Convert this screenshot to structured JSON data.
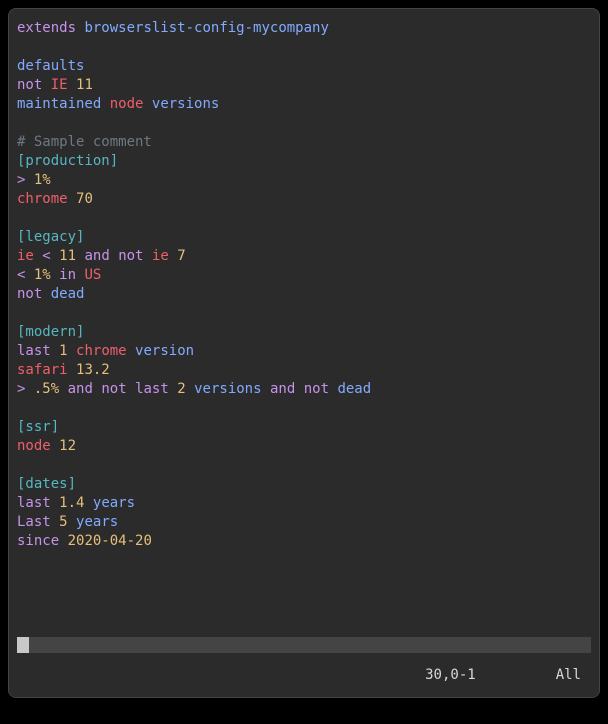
{
  "lines": [
    [
      [
        "keyword",
        "extends"
      ],
      [
        "plain",
        " "
      ],
      [
        "string",
        "browserslist-config-mycompany"
      ]
    ],
    [],
    [
      [
        "string",
        "defaults"
      ]
    ],
    [
      [
        "keyword",
        "not"
      ],
      [
        "plain",
        " "
      ],
      [
        "browser",
        "IE"
      ],
      [
        "plain",
        " "
      ],
      [
        "number",
        "11"
      ]
    ],
    [
      [
        "string",
        "maintained"
      ],
      [
        "plain",
        " "
      ],
      [
        "browser",
        "node"
      ],
      [
        "plain",
        " "
      ],
      [
        "string",
        "versions"
      ]
    ],
    [],
    [
      [
        "comment",
        "# Sample comment"
      ]
    ],
    [
      [
        "section",
        "[production]"
      ]
    ],
    [
      [
        "op",
        ">"
      ],
      [
        "plain",
        " "
      ],
      [
        "number",
        "1%"
      ]
    ],
    [
      [
        "browser",
        "chrome"
      ],
      [
        "plain",
        " "
      ],
      [
        "number",
        "70"
      ]
    ],
    [],
    [
      [
        "section",
        "[legacy]"
      ]
    ],
    [
      [
        "browser",
        "ie"
      ],
      [
        "plain",
        " "
      ],
      [
        "op",
        "<"
      ],
      [
        "plain",
        " "
      ],
      [
        "number",
        "11"
      ],
      [
        "plain",
        " "
      ],
      [
        "keyword",
        "and"
      ],
      [
        "plain",
        " "
      ],
      [
        "keyword",
        "not"
      ],
      [
        "plain",
        " "
      ],
      [
        "browser",
        "ie"
      ],
      [
        "plain",
        " "
      ],
      [
        "number",
        "7"
      ]
    ],
    [
      [
        "op",
        "<"
      ],
      [
        "plain",
        " "
      ],
      [
        "number",
        "1%"
      ],
      [
        "plain",
        " "
      ],
      [
        "keyword",
        "in"
      ],
      [
        "plain",
        " "
      ],
      [
        "browser",
        "US"
      ]
    ],
    [
      [
        "keyword",
        "not"
      ],
      [
        "plain",
        " "
      ],
      [
        "string",
        "dead"
      ]
    ],
    [],
    [
      [
        "section",
        "[modern]"
      ]
    ],
    [
      [
        "keyword",
        "last"
      ],
      [
        "plain",
        " "
      ],
      [
        "number",
        "1"
      ],
      [
        "plain",
        " "
      ],
      [
        "browser",
        "chrome"
      ],
      [
        "plain",
        " "
      ],
      [
        "string",
        "version"
      ]
    ],
    [
      [
        "browser",
        "safari"
      ],
      [
        "plain",
        " "
      ],
      [
        "number",
        "13.2"
      ]
    ],
    [
      [
        "op",
        ">"
      ],
      [
        "plain",
        " "
      ],
      [
        "number",
        ".5%"
      ],
      [
        "plain",
        " "
      ],
      [
        "keyword",
        "and"
      ],
      [
        "plain",
        " "
      ],
      [
        "keyword",
        "not"
      ],
      [
        "plain",
        " "
      ],
      [
        "keyword",
        "last"
      ],
      [
        "plain",
        " "
      ],
      [
        "number",
        "2"
      ],
      [
        "plain",
        " "
      ],
      [
        "string",
        "versions"
      ],
      [
        "plain",
        " "
      ],
      [
        "keyword",
        "and"
      ],
      [
        "plain",
        " "
      ],
      [
        "keyword",
        "not"
      ],
      [
        "plain",
        " "
      ],
      [
        "string",
        "dead"
      ]
    ],
    [],
    [
      [
        "section",
        "[ssr]"
      ]
    ],
    [
      [
        "browser",
        "node"
      ],
      [
        "plain",
        " "
      ],
      [
        "number",
        "12"
      ]
    ],
    [],
    [
      [
        "section",
        "[dates]"
      ]
    ],
    [
      [
        "keyword",
        "last"
      ],
      [
        "plain",
        " "
      ],
      [
        "number",
        "1.4"
      ],
      [
        "plain",
        " "
      ],
      [
        "string",
        "years"
      ]
    ],
    [
      [
        "keyword",
        "Last"
      ],
      [
        "plain",
        " "
      ],
      [
        "number",
        "5"
      ],
      [
        "plain",
        " "
      ],
      [
        "string",
        "years"
      ]
    ],
    [
      [
        "keyword",
        "since"
      ],
      [
        "plain",
        " "
      ],
      [
        "number",
        "2020-04-20"
      ]
    ]
  ],
  "status": {
    "position": "30,0-1",
    "scroll": "All"
  }
}
